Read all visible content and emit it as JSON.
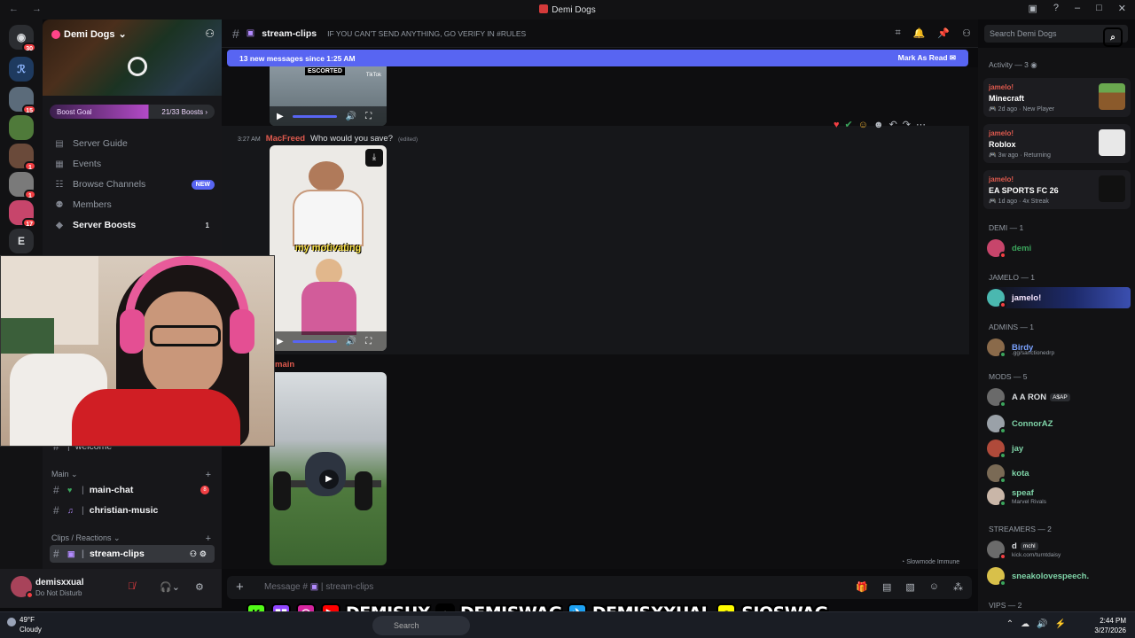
{
  "window": {
    "title": "Demi Dogs",
    "nav_arrows": "← →"
  },
  "guild_rail": {
    "badges": [
      "30",
      "15",
      "1",
      "1",
      "17"
    ],
    "letter_server": "E"
  },
  "server": {
    "name": "Demi Dogs",
    "boost_label": "Boost Goal",
    "boost_count": "21/33 Boosts",
    "boost_progress": 0.64,
    "nav": [
      {
        "label": "Server Guide"
      },
      {
        "label": "Events"
      },
      {
        "label": "Browse Channels",
        "tag": "NEW"
      },
      {
        "label": "Members"
      },
      {
        "label": "Server Boosts",
        "count": "1"
      }
    ]
  },
  "channels": {
    "welcome": "welcome",
    "cat_main": "Main",
    "main_chat": "main-chat",
    "main_chat_badge": "8",
    "christian_music": "christian-music",
    "cat_clips": "Clips / Reactions",
    "stream_clips": "stream-clips"
  },
  "user": {
    "name": "demisxxual",
    "status": "Do Not Disturb"
  },
  "header": {
    "channel": "stream-clips",
    "topic": "IF YOU CAN'T SEND ANYTHING, GO VERIFY IN #RULES",
    "search_placeholder": "Search Demi Dogs"
  },
  "new_messages": {
    "text": "13 new messages since 1:25 AM",
    "action": "Mark As Read"
  },
  "messages": [
    {
      "video_caption": "ESCORTED",
      "video_logo": "TikTok"
    },
    {
      "time": "3:27 AM",
      "author": "MacFreed",
      "text": "Who would you save?",
      "edited": "(edited)",
      "video_caption": "my motivating"
    },
    {
      "author_partial": "main"
    }
  ],
  "composer": {
    "placeholder": "Message #",
    "channel": "stream-clips",
    "slowmode": "Slowmode Immune"
  },
  "activity": {
    "heading": "Activity — 3",
    "items": [
      {
        "user": "jamelo!",
        "game": "Minecraft",
        "meta": "2d ago",
        "detail": "New Player"
      },
      {
        "user": "jamelo!",
        "game": "Roblox",
        "meta": "3w ago",
        "detail": "Returning"
      },
      {
        "user": "jamelo!",
        "game": "EA SPORTS FC 26",
        "meta": "1d ago",
        "detail": "4x Streak"
      }
    ]
  },
  "member_groups": {
    "demi": "DEMI — 1",
    "jamelo": "JAMELO — 1",
    "admins": "ADMINS — 1",
    "mods": "MODS — 5",
    "streamers": "STREAMERS — 2",
    "vips": "VIPS — 2"
  },
  "members": {
    "demi": "demi",
    "jamelo": "jamelo!",
    "birdy": "Birdy",
    "birdy_sub": ".gg/sanctionedrp",
    "aaron": "A A RON",
    "aaron_tag": "A$AP",
    "connor": "ConnorAZ",
    "jay": "jay",
    "kota": "kota",
    "speaf": "speaf",
    "speaf_sub": "Marvel Rivals",
    "d": "d",
    "d_tag": "mchl",
    "d_sub": "kick.com/turntdaisy",
    "sneak": "sneakolovespeech."
  },
  "socials": {
    "handles": [
      "DEMISUX",
      "DEMISWAG",
      "DEMISXXUAL",
      "SIOSWAG"
    ]
  },
  "taskbar": {
    "temp": "49°F",
    "weather": "Cloudy",
    "search": "Search",
    "time": "2:44 PM",
    "date": "3/27/2026"
  },
  "colors": {
    "blurple": "#5865f2",
    "red_author": "#e05a4e",
    "dnd": "#f23f43"
  }
}
